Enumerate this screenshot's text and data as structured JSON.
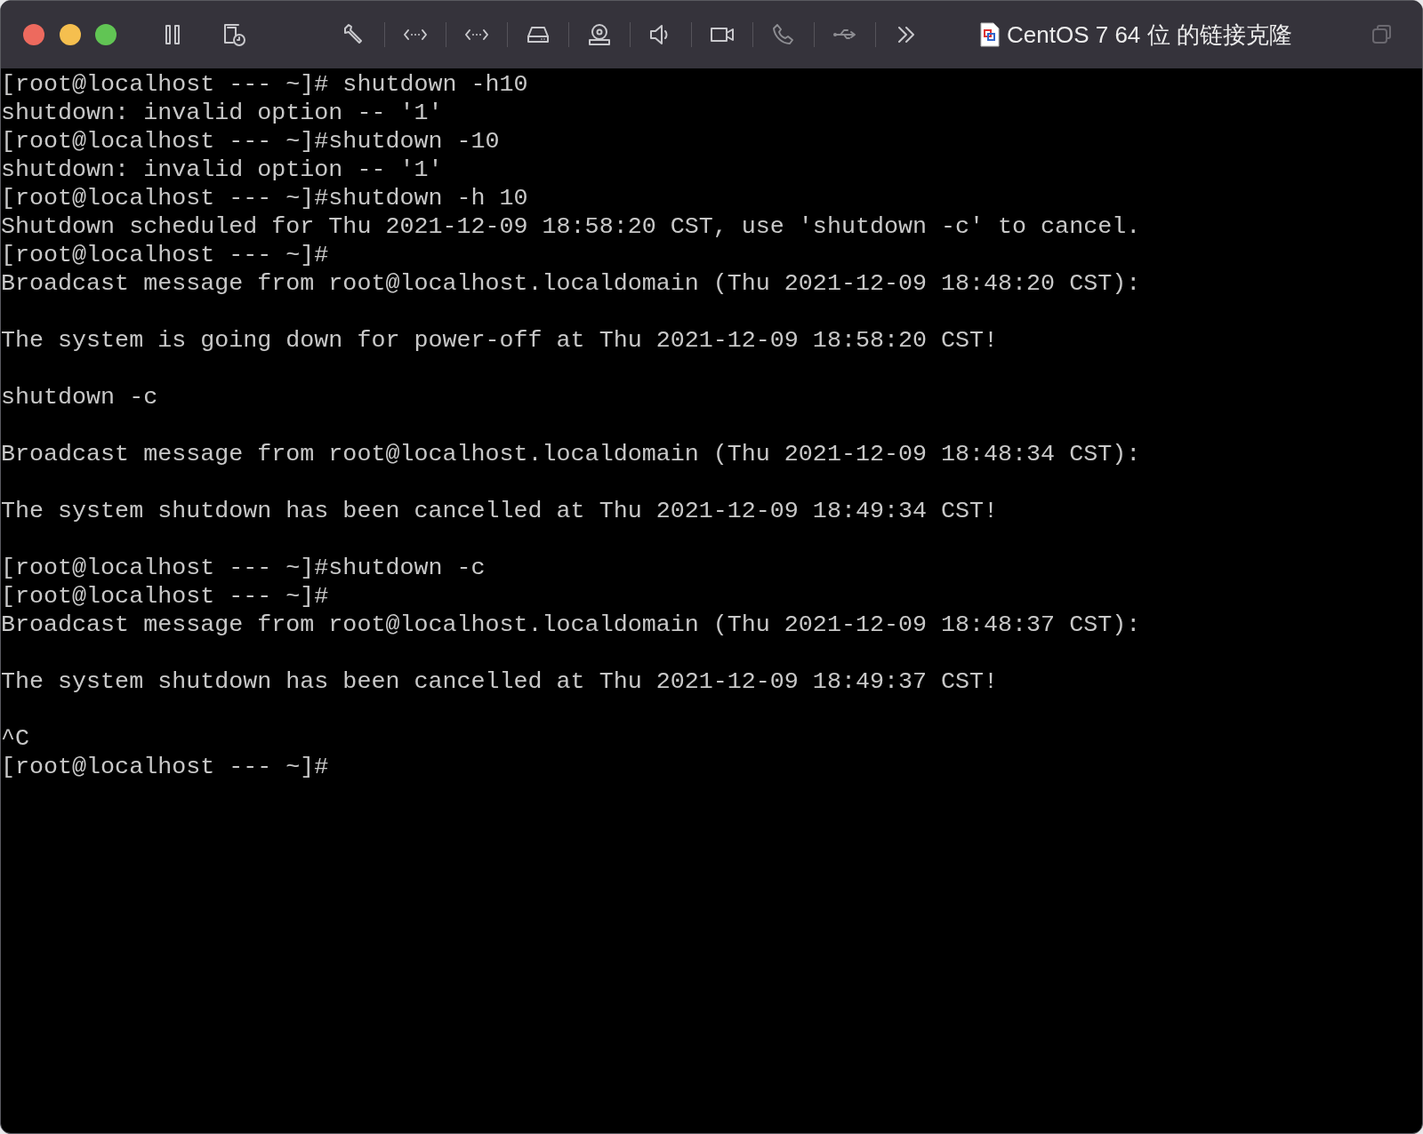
{
  "window": {
    "title": "CentOS 7 64 位 的链接克隆"
  },
  "terminal": {
    "blocks": [
      [
        "[root@localhost --- ~]# shutdown -h10",
        "shutdown: invalid option -- '1'",
        "[root@localhost --- ~]#shutdown -10",
        "shutdown: invalid option -- '1'",
        "[root@localhost --- ~]#shutdown -h 10",
        "Shutdown scheduled for Thu 2021-12-09 18:58:20 CST, use 'shutdown -c' to cancel.",
        "[root@localhost --- ~]#",
        "Broadcast message from root@localhost.localdomain (Thu 2021-12-09 18:48:20 CST):"
      ],
      [
        "The system is going down for power-off at Thu 2021-12-09 18:58:20 CST!"
      ],
      [
        "shutdown -c"
      ],
      [
        "Broadcast message from root@localhost.localdomain (Thu 2021-12-09 18:48:34 CST):"
      ],
      [
        "The system shutdown has been cancelled at Thu 2021-12-09 18:49:34 CST!"
      ],
      [
        "[root@localhost --- ~]#shutdown -c",
        "[root@localhost --- ~]#",
        "Broadcast message from root@localhost.localdomain (Thu 2021-12-09 18:48:37 CST):"
      ],
      [
        "The system shutdown has been cancelled at Thu 2021-12-09 18:49:37 CST!"
      ],
      [
        "^C",
        "[root@localhost --- ~]#"
      ]
    ]
  }
}
